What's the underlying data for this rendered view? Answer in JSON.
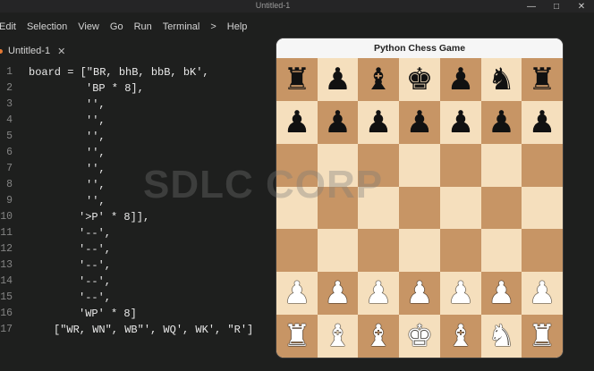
{
  "window": {
    "title": "Untitled-1",
    "controls": {
      "minimize": "—",
      "maximize": "□",
      "close": "✕"
    }
  },
  "menu": {
    "items": [
      "Edit",
      "Selection",
      "View",
      "Go",
      "Run",
      "Terminal",
      ">",
      "Help"
    ]
  },
  "tab": {
    "label": "Untitled-1",
    "close_icon": "✕"
  },
  "editor": {
    "lines": [
      {
        "n": "1",
        "text": "board = [\"BR, bhB, bbB, bK',"
      },
      {
        "n": "2",
        "text": "'BP * 8],"
      },
      {
        "n": "3",
        "text": "'',"
      },
      {
        "n": "4",
        "text": "'',"
      },
      {
        "n": "5",
        "text": "'',"
      },
      {
        "n": "6",
        "text": "'',"
      },
      {
        "n": "7",
        "text": "'',"
      },
      {
        "n": "8",
        "text": "'',"
      },
      {
        "n": "9",
        "text": "'',"
      },
      {
        "n": "10",
        "text": "'>P' * 8]],"
      },
      {
        "n": "11",
        "text": "'--',"
      },
      {
        "n": "12",
        "text": "'--',"
      },
      {
        "n": "13",
        "text": "'--',"
      },
      {
        "n": "14",
        "text": "'--',"
      },
      {
        "n": "15",
        "text": "'--',"
      },
      {
        "n": "16",
        "text": "'WP' * 8]"
      },
      {
        "n": "17",
        "text": "[\"WR, WN\", WB\"', WQ', WK', \"R']"
      }
    ]
  },
  "chess_window": {
    "title": "Python Chess Game",
    "light_color": "#f5dfbd",
    "dark_color": "#c79565",
    "rows": [
      [
        {
          "glyph": "♜",
          "color": "black",
          "name": "black-rook-icon"
        },
        {
          "glyph": "♟",
          "color": "black",
          "name": "black-pawn-icon"
        },
        {
          "glyph": "♝",
          "color": "black",
          "name": "black-bishop-icon"
        },
        {
          "glyph": "♚",
          "color": "black",
          "name": "black-king-icon"
        },
        {
          "glyph": "♟",
          "color": "black",
          "name": "black-pawn-icon"
        },
        {
          "glyph": "♞",
          "color": "black",
          "name": "black-knight-icon"
        },
        {
          "glyph": "♜",
          "color": "black",
          "name": "black-rook-icon"
        }
      ],
      [
        {
          "glyph": "♟",
          "color": "black",
          "name": "black-pawn-icon"
        },
        {
          "glyph": "♟",
          "color": "black",
          "name": "black-pawn-icon"
        },
        {
          "glyph": "♟",
          "color": "black",
          "name": "black-pawn-icon"
        },
        {
          "glyph": "♟",
          "color": "black",
          "name": "black-pawn-icon"
        },
        {
          "glyph": "♟",
          "color": "black",
          "name": "black-pawn-icon"
        },
        {
          "glyph": "♟",
          "color": "black",
          "name": "black-pawn-icon"
        },
        {
          "glyph": "♟",
          "color": "black",
          "name": "black-pawn-icon"
        }
      ],
      [
        null,
        null,
        null,
        null,
        null,
        null,
        null
      ],
      [
        null,
        null,
        null,
        null,
        null,
        null,
        null
      ],
      [
        null,
        null,
        null,
        null,
        null,
        null,
        null
      ],
      [
        {
          "glyph": "♟",
          "color": "white",
          "name": "white-pawn-icon"
        },
        {
          "glyph": "♟",
          "color": "white",
          "name": "white-pawn-icon"
        },
        {
          "glyph": "♟",
          "color": "white",
          "name": "white-pawn-icon"
        },
        {
          "glyph": "♟",
          "color": "white",
          "name": "white-pawn-icon"
        },
        {
          "glyph": "♟",
          "color": "white",
          "name": "white-pawn-icon"
        },
        {
          "glyph": "♟",
          "color": "white",
          "name": "white-pawn-icon"
        },
        {
          "glyph": "♟",
          "color": "white",
          "name": "white-pawn-icon"
        }
      ],
      [
        {
          "glyph": "♜",
          "color": "white",
          "name": "white-rook-icon"
        },
        {
          "glyph": "♝",
          "color": "white",
          "name": "white-bishop-icon"
        },
        {
          "glyph": "♝",
          "color": "white",
          "name": "white-bishop-icon"
        },
        {
          "glyph": "♚",
          "color": "white",
          "name": "white-king-icon"
        },
        {
          "glyph": "♝",
          "color": "white",
          "name": "white-bishop-icon"
        },
        {
          "glyph": "♞",
          "color": "white",
          "name": "white-knight-icon"
        },
        {
          "glyph": "♜",
          "color": "white",
          "name": "white-rook-icon"
        }
      ]
    ]
  },
  "watermark": {
    "text": "SDLC CORP"
  }
}
